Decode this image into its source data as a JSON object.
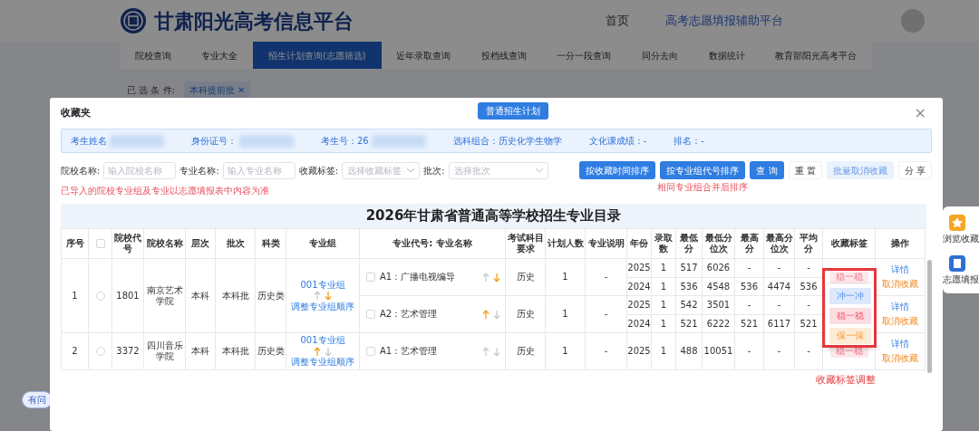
{
  "site": {
    "title": "甘肃阳光高考信息平台",
    "links": [
      {
        "label": "首页",
        "kind": "plain"
      },
      {
        "label": "高考志愿填报辅助平台",
        "kind": "accent"
      }
    ],
    "nav": [
      {
        "label": "院校查询",
        "selected": false
      },
      {
        "label": "专业大全",
        "selected": false
      },
      {
        "label": "招生计划查询(志愿筛选)",
        "selected": true
      },
      {
        "label": "近年录取查询",
        "selected": false
      },
      {
        "label": "投档线查询",
        "selected": false
      },
      {
        "label": "一分一段查询",
        "selected": false
      },
      {
        "label": "同分去向",
        "selected": false
      },
      {
        "label": "数据统计",
        "selected": false
      },
      {
        "label": "教育部阳光高考平台",
        "selected": false
      }
    ],
    "filter_label": "已 选 条 件:",
    "filter_tag": {
      "label": "本科提前批",
      "close": "✕"
    },
    "side_buttons": [
      {
        "label": "浏览收藏",
        "kind": "star"
      },
      {
        "label": "志愿填报",
        "kind": "book"
      }
    ],
    "help_badge": "有问"
  },
  "modal": {
    "title": "收藏夹",
    "plan_button": "普通招生计划",
    "close": "×",
    "info": [
      {
        "label": "考生姓名",
        "redacted": true
      },
      {
        "label": "身份证号：",
        "redacted": true
      },
      {
        "label": "考生号：26",
        "redacted": true
      },
      {
        "label": "选科组合：历史化学生物学",
        "redacted": false
      },
      {
        "label": "文化课成绩：-",
        "redacted": false
      },
      {
        "label": "排名：-",
        "redacted": false
      }
    ],
    "filters": [
      {
        "label": "院校名称:",
        "placeholder": "输入院校名称",
        "kind": "input"
      },
      {
        "label": "专业名称:",
        "placeholder": "输入专业名称",
        "kind": "input"
      },
      {
        "label": "收藏标签:",
        "placeholder": "选择收藏标签",
        "kind": "select"
      },
      {
        "label": "批次:",
        "placeholder": "选择批次",
        "kind": "select"
      }
    ],
    "buttons": [
      {
        "label": "按收藏时间排序",
        "kind": "primary"
      },
      {
        "label": "按专业组代号排序",
        "kind": "primary",
        "note": "相同专业组合并后排序"
      },
      {
        "label": "查 询",
        "kind": "primary"
      },
      {
        "label": "重 置",
        "kind": "plain"
      },
      {
        "label": "批量取消收藏",
        "kind": "light"
      },
      {
        "label": "分 享",
        "kind": "plain"
      }
    ],
    "notice": "已导入的院校专业组及专业以志愿填报表中内容为准",
    "table": {
      "title": "2026年甘肃省普通高等学校招生专业目录",
      "header_checked": false,
      "columns": [
        "序号",
        "",
        "院校代号",
        "院校名称",
        "层次",
        "批次",
        "科类",
        "专业组",
        "专业代号: 专业名称",
        "考试科目要求",
        "计划人数",
        "专业说明",
        "年份",
        "录取数",
        "最低分",
        "最低分位次",
        "最高分",
        "最高分位次",
        "平均分",
        "收藏标签",
        "操作"
      ],
      "rows": [
        {
          "no": "1",
          "checked": false,
          "code": "1801",
          "school": "南京艺术学院",
          "level": "本科",
          "batch": "本科批",
          "category": "历史类",
          "group": {
            "label": "001专业组",
            "up_active": false,
            "down_active": true,
            "adjust": "调整专业组顺序"
          },
          "majors": [
            {
              "checked": false,
              "name": "A1：广播电视编导",
              "up_active": false,
              "down_active": true,
              "subject": "历史",
              "plan": "1",
              "note": "-",
              "years": [
                {
                  "year": "2025",
                  "admitted": "1",
                  "min": "517",
                  "min_rank": "6026",
                  "max": "-",
                  "max_rank": "-",
                  "avg": "-"
                },
                {
                  "year": "2024",
                  "admitted": "1",
                  "min": "536",
                  "min_rank": "4548",
                  "max": "536",
                  "max_rank": "4474",
                  "avg": "536"
                }
              ],
              "tag": {
                "label": "稳一稳",
                "color": "#fde8eb"
              },
              "menu_open": true,
              "actions": [
                {
                  "label": "详情",
                  "kind": "detail"
                },
                {
                  "label": "取消收藏",
                  "kind": "cancel"
                }
              ]
            },
            {
              "checked": false,
              "name": "A2：艺术管理",
              "up_active": true,
              "down_active": false,
              "subject": "历史",
              "plan": "1",
              "note": "-",
              "years": [
                {
                  "year": "2025",
                  "admitted": "1",
                  "min": "542",
                  "min_rank": "3501",
                  "max": "-",
                  "max_rank": "-",
                  "avg": "-"
                },
                {
                  "year": "2024",
                  "admitted": "1",
                  "min": "521",
                  "min_rank": "6222",
                  "max": "521",
                  "max_rank": "6117",
                  "avg": "521"
                }
              ],
              "menu_open": false,
              "actions": [
                {
                  "label": "详情",
                  "kind": "detail"
                },
                {
                  "label": "取消收藏",
                  "kind": "cancel"
                }
              ]
            }
          ]
        },
        {
          "no": "2",
          "checked": false,
          "code": "3372",
          "school": "四川音乐学院",
          "level": "本科",
          "batch": "本科批",
          "category": "历史类",
          "group": {
            "label": "001专业组",
            "up_active": true,
            "down_active": false,
            "adjust": "调整专业组顺序"
          },
          "majors": [
            {
              "checked": false,
              "name": "A1：艺术管理",
              "up_active": false,
              "down_active": false,
              "subject": "历史",
              "plan": "1",
              "note": "-",
              "years": [
                {
                  "year": "2025",
                  "admitted": "1",
                  "min": "488",
                  "min_rank": "10051",
                  "max": "-",
                  "max_rank": "-",
                  "avg": "-"
                }
              ],
              "tag": {
                "label": "稳一稳",
                "color": "#fde8eb"
              },
              "menu_open": false,
              "actions": [
                {
                  "label": "详情",
                  "kind": "detail"
                },
                {
                  "label": "取消收藏",
                  "kind": "cancel"
                }
              ]
            }
          ]
        }
      ]
    },
    "tag_menu": [
      {
        "label": "冲一冲",
        "color": "#dce9fc"
      },
      {
        "label": "稳一稳",
        "color": "#fcdde2"
      },
      {
        "label": "保一保",
        "color": "#fdebd6"
      }
    ],
    "annotation": "收藏标签调整"
  }
}
